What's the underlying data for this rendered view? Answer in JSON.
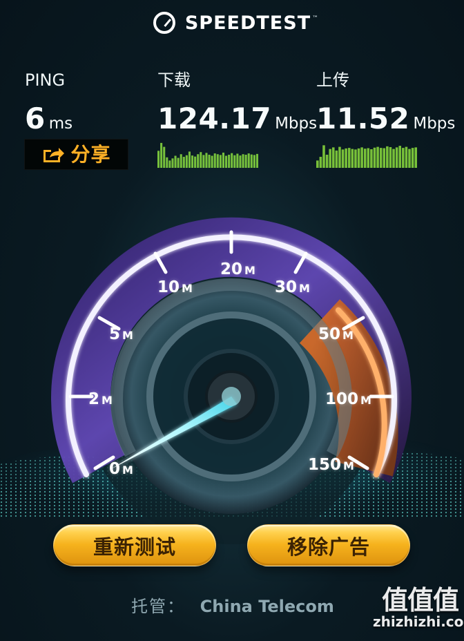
{
  "app": {
    "brand": "SPEEDTEST",
    "trademark": "™"
  },
  "metrics": {
    "ping": {
      "title": "PING",
      "value": "6",
      "unit": "ms"
    },
    "download": {
      "title": "下载",
      "value": "124.17",
      "unit": "Mbps",
      "graph_color": "#82d33f",
      "graph_values": [
        0.65,
        0.95,
        0.8,
        0.4,
        0.28,
        0.36,
        0.46,
        0.38,
        0.52,
        0.42,
        0.48,
        0.62,
        0.47,
        0.43,
        0.52,
        0.6,
        0.49,
        0.57,
        0.5,
        0.46,
        0.55,
        0.52,
        0.49,
        0.58,
        0.46,
        0.5,
        0.56,
        0.48,
        0.54,
        0.47,
        0.52,
        0.5,
        0.55,
        0.51,
        0.49,
        0.53
      ]
    },
    "upload": {
      "title": "上传",
      "value": "11.52",
      "unit": "Mbps",
      "graph_color": "#84d33c",
      "graph_values": [
        0.28,
        0.42,
        0.86,
        0.5,
        0.72,
        0.78,
        0.66,
        0.8,
        0.7,
        0.74,
        0.76,
        0.72,
        0.7,
        0.74,
        0.78,
        0.73,
        0.75,
        0.71,
        0.77,
        0.8,
        0.76,
        0.75,
        0.82,
        0.79,
        0.72,
        0.78,
        0.84,
        0.76,
        0.8,
        0.72,
        0.76,
        0.78
      ]
    }
  },
  "share": {
    "label": "分享",
    "icon": "share-icon",
    "accent": "#ffb126"
  },
  "gauge": {
    "labels": [
      {
        "value": "0",
        "suffix": "M"
      },
      {
        "value": "2",
        "suffix": "M"
      },
      {
        "value": "5",
        "suffix": "M"
      },
      {
        "value": "10",
        "suffix": "M"
      },
      {
        "value": "20",
        "suffix": "M"
      },
      {
        "value": "30",
        "suffix": "M"
      },
      {
        "value": "50",
        "suffix": "M"
      },
      {
        "value": "100",
        "suffix": "M"
      },
      {
        "value": "150",
        "suffix": "M"
      }
    ],
    "colors": {
      "ring": "#58399e",
      "ring_inner": "#36205f",
      "highlight": "#ff8f3c",
      "needle": "#a6fbff"
    }
  },
  "buttons": {
    "retest": "重新测试",
    "remove_ads": "移除广告"
  },
  "server": {
    "label": "托管：",
    "provider": "China Telecom"
  },
  "watermark": {
    "big": "值值值",
    "small": "zhizhizhi.com"
  }
}
